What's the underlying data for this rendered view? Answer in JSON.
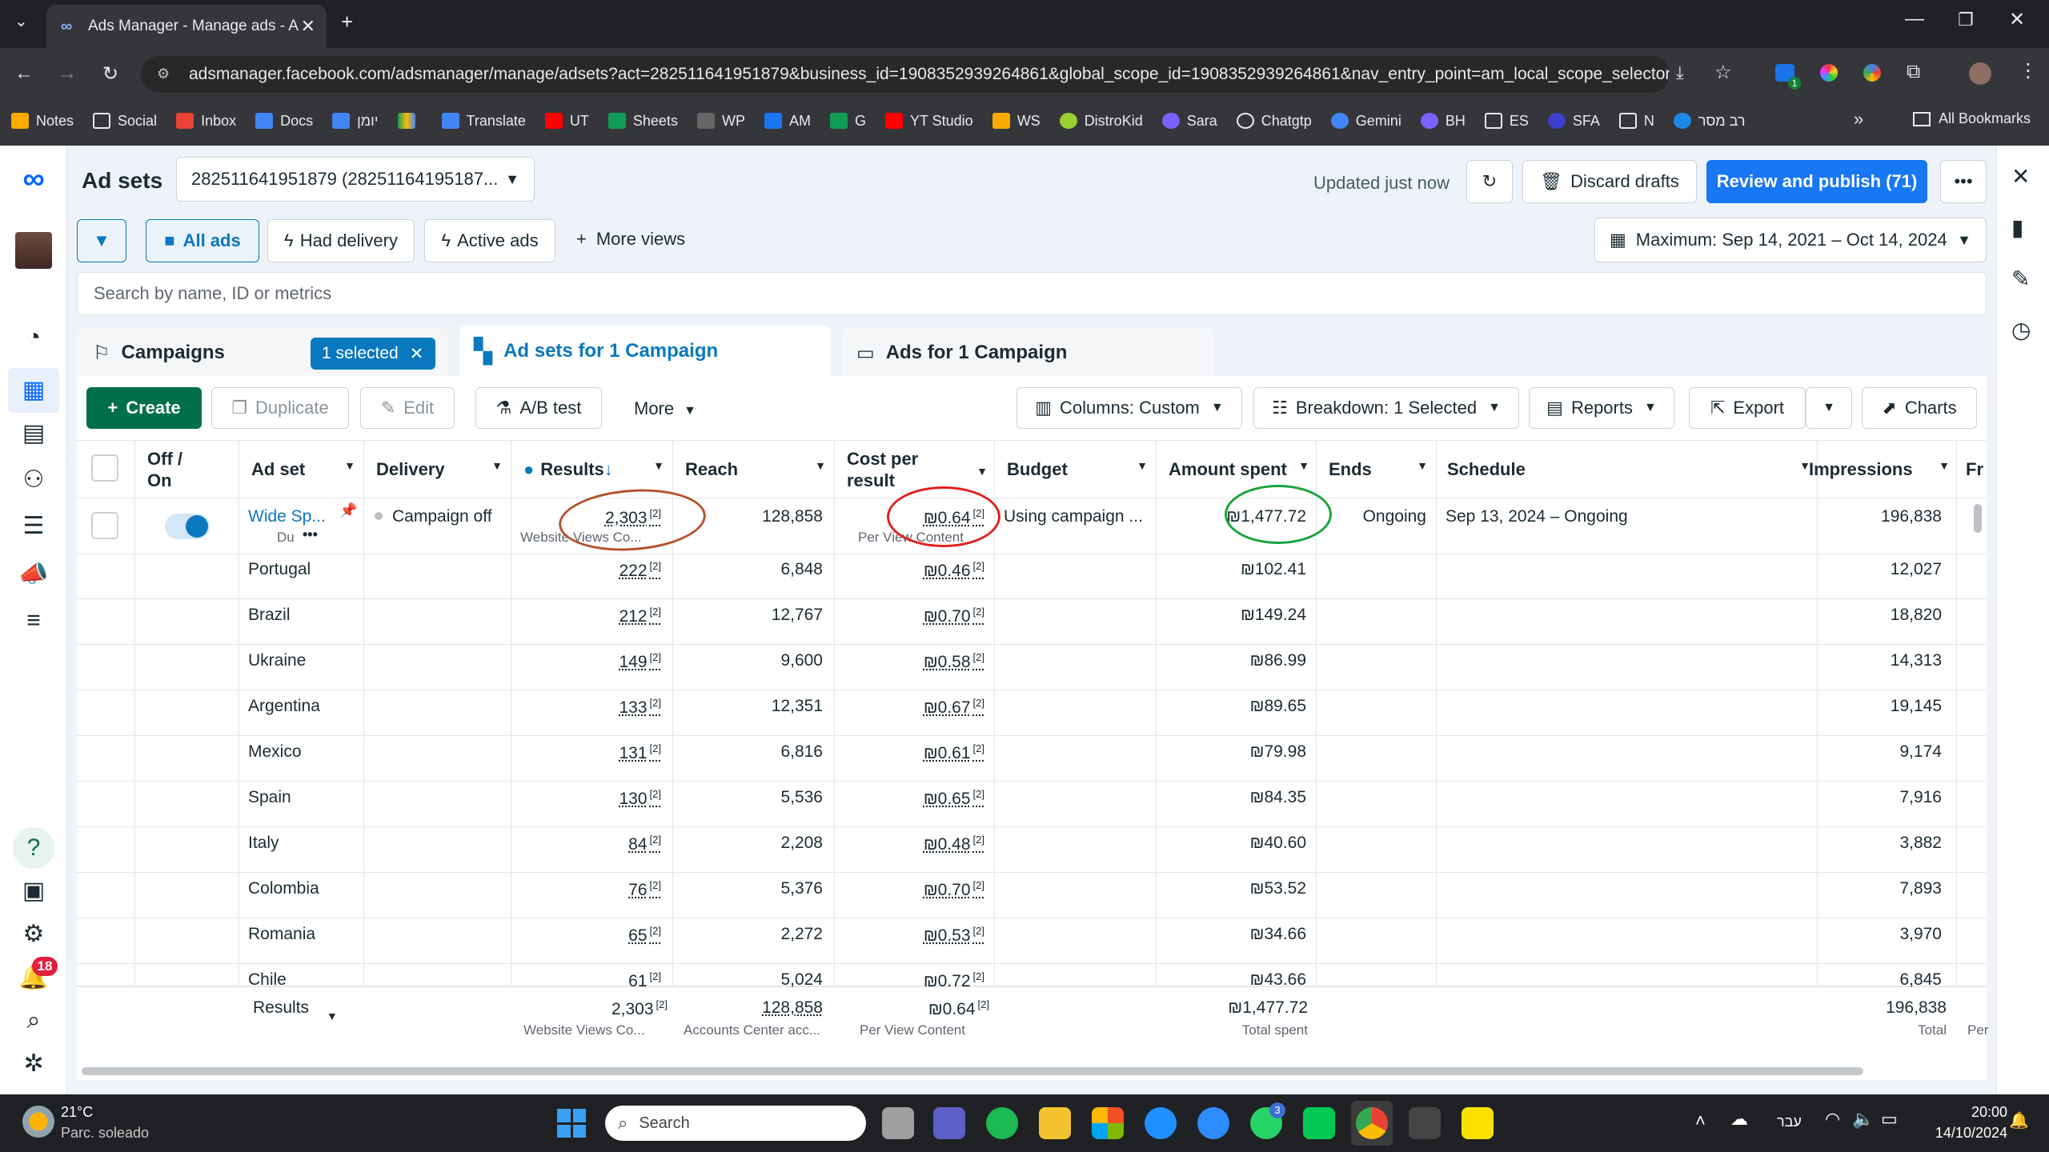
{
  "browser": {
    "tab_title": "Ads Manager - Manage ads - A",
    "url": "adsmanager.facebook.com/adsmanager/manage/adsets?act=282511641951879&business_id=1908352939264861&global_scope_id=1908352939264861&nav_entry_point=am_local_scope_selector...",
    "bookmarks": [
      "Notes",
      "Social",
      "Inbox",
      "Docs",
      "יומן",
      "",
      "Translate",
      "UT",
      "Sheets",
      "WP",
      "AM",
      "G",
      "YT Studio",
      "WS",
      "DistroKid",
      "Sara",
      "Chatgtp",
      "Gemini",
      "BH",
      "ES",
      "SFA",
      "N",
      "רב מסר"
    ],
    "all_bookmarks": "All Bookmarks"
  },
  "header": {
    "title": "Ad sets",
    "account": "282511641951879 (28251164195187...",
    "updated": "Updated just now",
    "discard": "Discard drafts",
    "review": "Review and publish (71)"
  },
  "filters": {
    "all_ads": "All ads",
    "had_delivery": "Had delivery",
    "active_ads": "Active ads",
    "more_views": "More views",
    "date": "Maximum: Sep 14, 2021 – Oct 14, 2024"
  },
  "search": {
    "placeholder": "Search by name, ID or metrics"
  },
  "tabs": {
    "campaigns": "Campaigns",
    "selected": "1 selected",
    "adsets": "Ad sets for 1 Campaign",
    "ads": "Ads for 1 Campaign"
  },
  "toolbar": {
    "create": "Create",
    "duplicate": "Duplicate",
    "edit": "Edit",
    "ab": "A/B test",
    "more": "More",
    "columns": "Columns: Custom",
    "breakdown": "Breakdown: 1 Selected",
    "reports": "Reports",
    "export": "Export",
    "charts": "Charts"
  },
  "columns": {
    "offon": "Off / On",
    "adset": "Ad set",
    "delivery": "Delivery",
    "results": "Results",
    "reach": "Reach",
    "cpr": "Cost per result",
    "budget": "Budget",
    "spent": "Amount spent",
    "ends": "Ends",
    "schedule": "Schedule",
    "impressions": "Impressions",
    "fr": "Fr"
  },
  "main_row": {
    "adset": "Wide Sp...",
    "adset_sub": "Du",
    "delivery": "Campaign off",
    "results": "2,303",
    "results_sub": "Website Views Co...",
    "reach": "128,858",
    "cpr": "₪0.64",
    "cpr_sub": "Per View Content",
    "budget": "Using campaign ...",
    "spent": "₪1,477.72",
    "ends": "Ongoing",
    "schedule": "Sep 13, 2024 – Ongoing",
    "impressions": "196,838"
  },
  "rows": [
    {
      "country": "Portugal",
      "results": "222",
      "reach": "6,848",
      "cpr": "₪0.46",
      "spent": "₪102.41",
      "impressions": "12,027"
    },
    {
      "country": "Brazil",
      "results": "212",
      "reach": "12,767",
      "cpr": "₪0.70",
      "spent": "₪149.24",
      "impressions": "18,820"
    },
    {
      "country": "Ukraine",
      "results": "149",
      "reach": "9,600",
      "cpr": "₪0.58",
      "spent": "₪86.99",
      "impressions": "14,313"
    },
    {
      "country": "Argentina",
      "results": "133",
      "reach": "12,351",
      "cpr": "₪0.67",
      "spent": "₪89.65",
      "impressions": "19,145"
    },
    {
      "country": "Mexico",
      "results": "131",
      "reach": "6,816",
      "cpr": "₪0.61",
      "spent": "₪79.98",
      "impressions": "9,174"
    },
    {
      "country": "Spain",
      "results": "130",
      "reach": "5,536",
      "cpr": "₪0.65",
      "spent": "₪84.35",
      "impressions": "7,916"
    },
    {
      "country": "Italy",
      "results": "84",
      "reach": "2,208",
      "cpr": "₪0.48",
      "spent": "₪40.60",
      "impressions": "3,882"
    },
    {
      "country": "Colombia",
      "results": "76",
      "reach": "5,376",
      "cpr": "₪0.70",
      "spent": "₪53.52",
      "impressions": "7,893"
    },
    {
      "country": "Romania",
      "results": "65",
      "reach": "2,272",
      "cpr": "₪0.53",
      "spent": "₪34.66",
      "impressions": "3,970"
    },
    {
      "country": "Chile",
      "results": "61",
      "reach": "5,024",
      "cpr": "₪0.72",
      "spent": "₪43.66",
      "impressions": "6,845"
    }
  ],
  "summary": {
    "label": "Results",
    "results": "2,303",
    "results_sub": "Website Views Co...",
    "reach": "128,858",
    "reach_sub": "Accounts Center acc...",
    "cpr": "₪0.64",
    "cpr_sub": "Per View Content",
    "spent": "₪1,477.72",
    "spent_sub": "Total spent",
    "impressions": "196,838",
    "imp_sub": "Total",
    "fr_sub": "Per"
  },
  "taskbar": {
    "temp": "21°C",
    "weather": "Parc. soleado",
    "search": "Search",
    "lang": "עבר",
    "time": "20:00",
    "date": "14/10/2024"
  },
  "badges": {
    "notifications": "18",
    "whatsapp": "3",
    "ext": "1"
  },
  "footnote": "[2]",
  "colors": {
    "primary": "#0a78be",
    "create": "#00704a",
    "review": "#1877f2",
    "annot_brown": "#b5532d",
    "annot_red": "#e02020",
    "annot_green": "#1aa33a"
  }
}
